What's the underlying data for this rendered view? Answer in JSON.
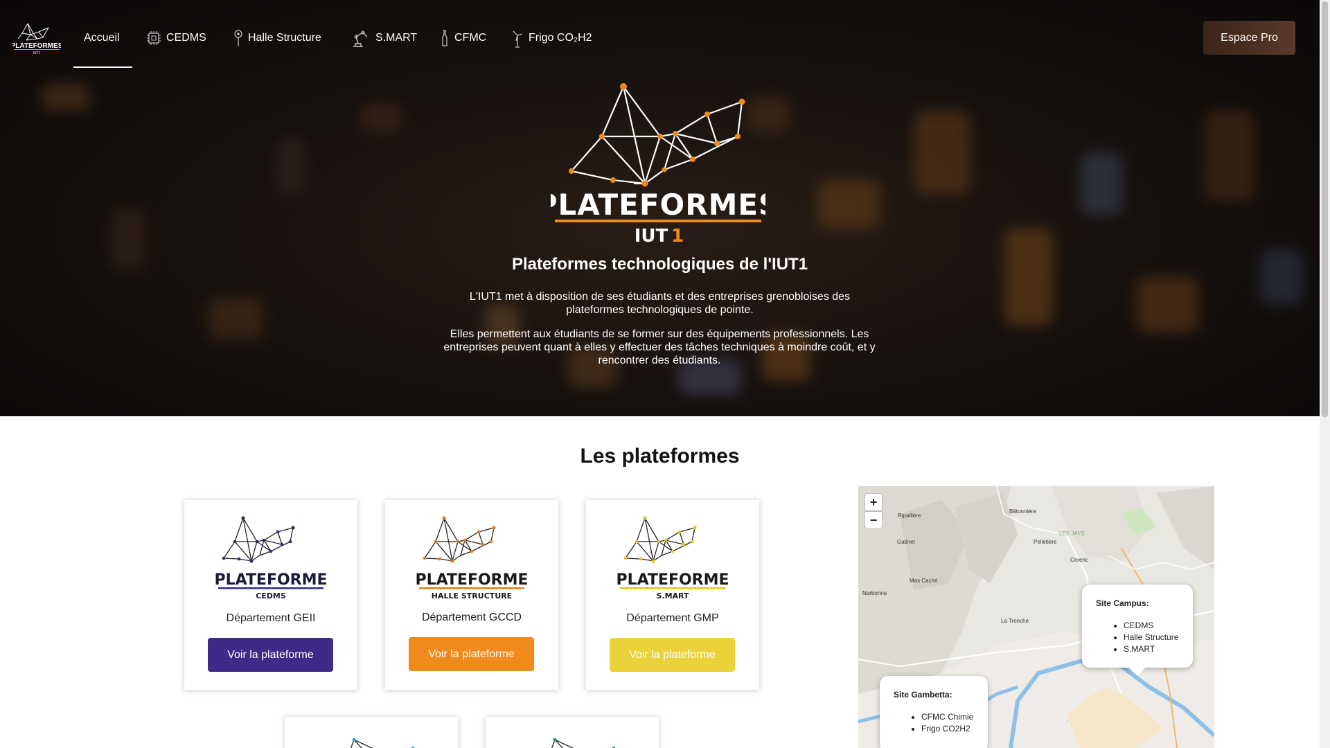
{
  "nav": {
    "logo_alt": "PLATEFORMES IUT1",
    "items": [
      {
        "label": "Accueil",
        "icon": "none"
      },
      {
        "label": "CEDMS",
        "icon": "chip-icon"
      },
      {
        "label": "Halle Structure",
        "icon": "pin-icon"
      },
      {
        "label": "S.MART",
        "icon": "robot-arm-icon"
      },
      {
        "label": "CFMC",
        "icon": "pipette-icon"
      },
      {
        "label": "Frigo CO₂H2",
        "icon": "wind-turbine-icon"
      }
    ],
    "active": "Accueil",
    "espace_pro": "Espace Pro"
  },
  "hero": {
    "logo_word": "PLATEFORMES",
    "logo_sub": "IUT",
    "logo_sub_num": "1",
    "title": "Plateformes technologiques de l'IUT1",
    "p1": "L'IUT1 met à disposition de ses étudiants et des entreprises grenobloises des plateformes technologiques de pointe.",
    "p2": "Elles permettent aux étudiants de se former sur des équipements professionnels. Les entreprises peuvent quant à elles y effectuer des tâches techniques à moindre coût, et y rencontrer des étudiants."
  },
  "section": {
    "title": "Les plateformes"
  },
  "cards": [
    {
      "logo_word": "PLATEFORME",
      "logo_sub": "CEDMS",
      "dept": "Département GEII",
      "button": "Voir la plateforme",
      "color": "#3e2a87",
      "line": "#2d2a7a"
    },
    {
      "logo_word": "PLATEFORME",
      "logo_sub": "HALLE STRUCTURE",
      "dept": "Département GCCD",
      "button": "Voir la plateforme",
      "color": "#f08a1c",
      "line": "#e67c10"
    },
    {
      "logo_word": "PLATEFORME",
      "logo_sub": "S.MART",
      "dept": "Département GMP",
      "button": "Voir la plateforme",
      "color": "#ecd23a",
      "line": "#e3c21a"
    }
  ],
  "map": {
    "zoom_in": "+",
    "zoom_out": "−",
    "campus": {
      "title": "Site Campus:",
      "items": [
        "CEDMS",
        "Halle Structure",
        "S.MART"
      ]
    },
    "gambetta": {
      "title": "Site Gambetta:",
      "items": [
        "CFMC Chimie",
        "Frigo CO2H2"
      ]
    },
    "labels": [
      "Ripaillère",
      "Bâtonnière",
      "Gatinet",
      "Pelletière",
      "Corenc",
      "Mas Caché",
      "Narbonne",
      "La Tronche",
      "LES JAYS"
    ]
  },
  "colors": {
    "accent_orange": "#f08a1c",
    "purple": "#3e2a87",
    "yellow": "#ecd23a"
  }
}
